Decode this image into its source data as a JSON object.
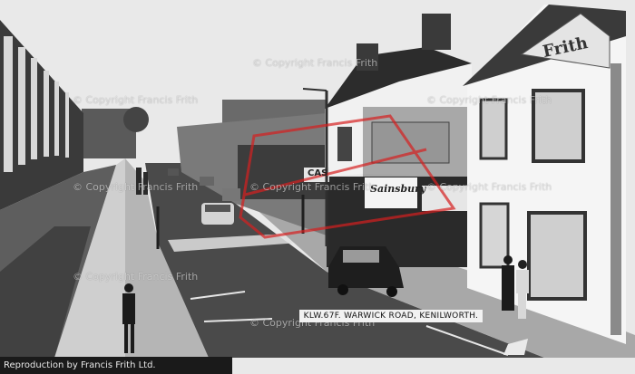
{
  "watermark_text": "© Copyright Francis Frith",
  "signs": {
    "shop_left": "CAS",
    "shop_sainsbury": "Sainsbury",
    "pub_name": "Frith"
  },
  "caption": "KLW.67F.    WARWICK ROAD, KENILWORTH.",
  "credit": "Reproduction by Francis Frith Ltd.",
  "colors": {
    "sky": "#e9e9e9",
    "road": "#4a4a4a",
    "pavement": "#9a9a9a",
    "watermark_red": "#d62020"
  }
}
